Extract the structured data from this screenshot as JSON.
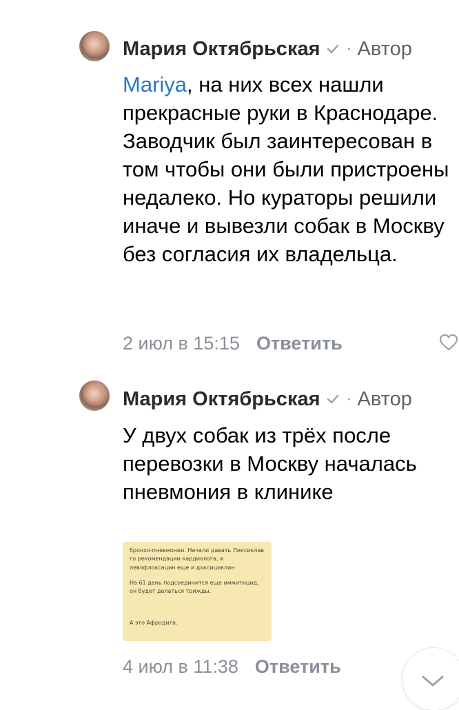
{
  "comments": [
    {
      "author": "Мария Октябрьская",
      "role": "Автор",
      "separator": "·",
      "mention": "Mariya",
      "text_after_mention": ", на них всех нашли прекрасные руки в Краснодаре. Заводчик был заинтересован в том чтобы они были пристроены недалеко. Но кураторы решили иначе и вывезли собак в Москву без согласия их владельца.",
      "timestamp": "2 июл в 15:15",
      "reply_label": "Ответить"
    },
    {
      "author": "Мария Октябрьская",
      "role": "Автор",
      "separator": "·",
      "text": "У двух собак из трёх после перевозки в Москву началась пневмония в клинике",
      "attachment_lines": [
        "бронхо-пневмонии. Начали давать Ликсиклав",
        "го рекомендации кардиолога, и",
        "левофлоксацин еще и доксициклин",
        "На  61 день подсоединится еще иммитицид,",
        "он будет делаться трижды.",
        "А это Афродита."
      ],
      "timestamp": "4 июл в 11:38",
      "reply_label": "Ответить"
    }
  ],
  "icons": {
    "verified": "checkmark-icon",
    "like": "heart-icon",
    "scroll": "chevron-down-icon"
  },
  "colors": {
    "mention": "#2a78c7",
    "meta": "#8a9099",
    "attachment_bg": "#f6e8b0"
  }
}
